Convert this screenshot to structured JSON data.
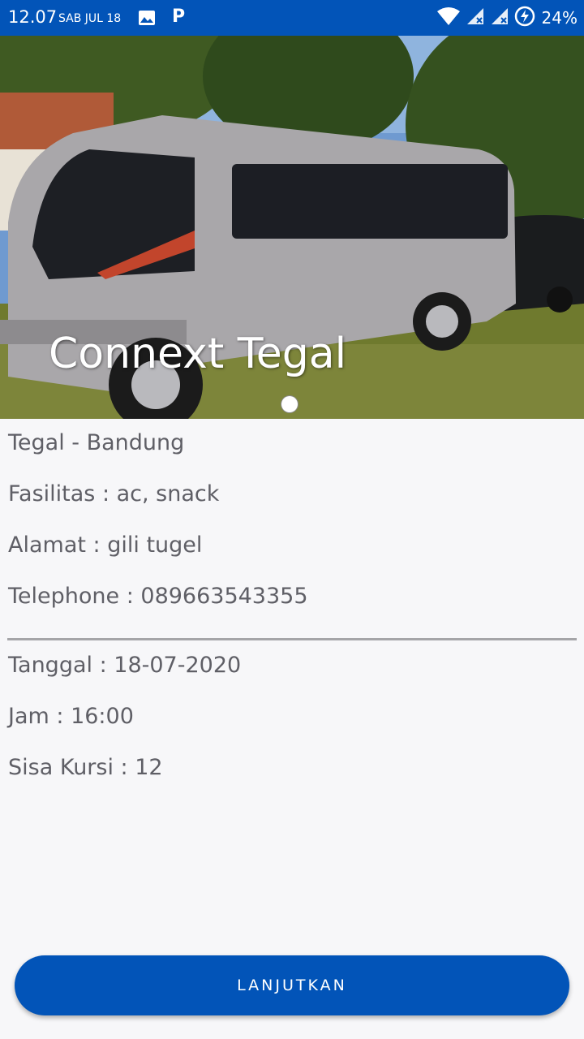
{
  "status_bar": {
    "time": "12.07",
    "date": "SAB JUL 18",
    "battery": "24%",
    "icons": [
      "gallery-icon",
      "parking-icon",
      "wifi-icon",
      "signal-icon",
      "signal-icon",
      "battery-saver-icon"
    ]
  },
  "hero": {
    "title": "Connext Tegal",
    "image": "minibus-photo"
  },
  "details": {
    "route": "Tegal - Bandung",
    "facilities": "Fasilitas : ac, snack",
    "address": "Alamat : gili tugel",
    "phone": "Telephone : 089663543355"
  },
  "schedule": {
    "date": "Tanggal : 18-07-2020",
    "time": "Jam : 16:00",
    "seats": "Sisa Kursi : 12"
  },
  "action": {
    "label": "LANJUTKAN"
  },
  "colors": {
    "primary": "#0254b8",
    "background": "#f7f7f9",
    "text": "#5f5f66"
  }
}
